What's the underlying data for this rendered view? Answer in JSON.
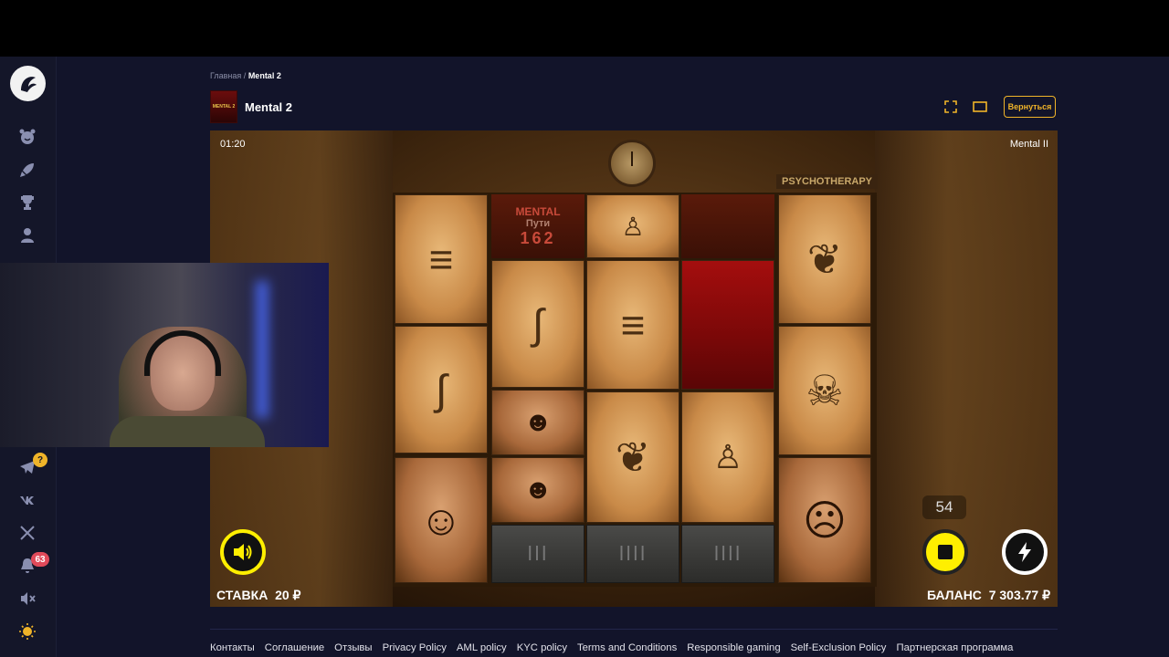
{
  "breadcrumb": {
    "home": "Главная",
    "separator": "/",
    "current": "Mental 2"
  },
  "game": {
    "title": "Mental 2",
    "thumb_text": "MENTAL 2",
    "back_label": "Вернуться",
    "timer": "01:20",
    "provider_name": "Mental II",
    "ways_label": "Пути",
    "ways_value": "162",
    "mental_label": "MENTAL",
    "psycho_label": "PSYCHOTHERAPY",
    "spin_counter": "54",
    "stake_label": "СТАВКА",
    "stake_value": "20 ₽",
    "balance_label": "БАЛАНС",
    "balance_value": "7 303.77 ₽",
    "accent_color": "#f0b429",
    "symbols": [
      "ribcage",
      "foot",
      "skull-curled",
      "spine",
      "ribcage",
      "blood-wild",
      "spine",
      "mummy-face",
      "skull-curled",
      "foot",
      "skull",
      "girl-face",
      "mummy-face",
      "girl-face"
    ]
  },
  "sidebar": {
    "help_badge": "?",
    "notification_count": "63",
    "icons": [
      "logo-icon",
      "smile-icon",
      "rocket-icon",
      "trophy-icon",
      "user-icon",
      "telegram-icon",
      "vk-icon",
      "x-icon",
      "bell-icon",
      "mute-icon",
      "sun-icon"
    ]
  },
  "footer": {
    "links": [
      "Контакты",
      "Соглашение",
      "Отзывы",
      "Privacy Policy",
      "AML policy",
      "KYC policy",
      "Terms and Conditions",
      "Responsible gaming",
      "Self-Exclusion Policy",
      "Партнерская программа"
    ]
  }
}
